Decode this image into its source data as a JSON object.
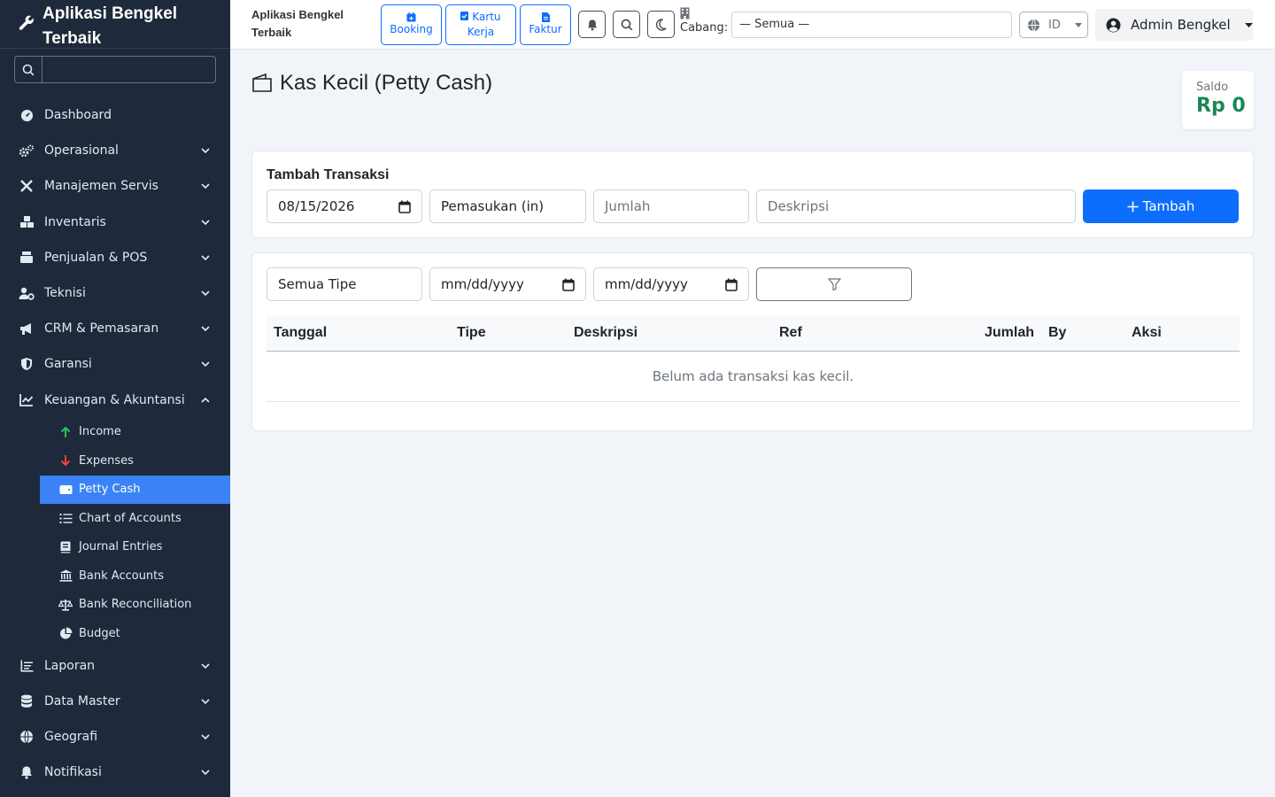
{
  "sidebar": {
    "brand": "Aplikasi Bengkel Terbaik",
    "search_placeholder": "",
    "items": [
      {
        "label": "Dashboard"
      },
      {
        "label": "Operasional"
      },
      {
        "label": "Manajemen Servis"
      },
      {
        "label": "Inventaris"
      },
      {
        "label": "Penjualan & POS"
      },
      {
        "label": "Teknisi"
      },
      {
        "label": "CRM & Pemasaran"
      },
      {
        "label": "Garansi"
      },
      {
        "label": "Keuangan & Akuntansi"
      }
    ],
    "sub_items": [
      {
        "label": "Income"
      },
      {
        "label": "Expenses"
      },
      {
        "label": "Petty Cash"
      },
      {
        "label": "Chart of Accounts"
      },
      {
        "label": "Journal Entries"
      },
      {
        "label": "Bank Accounts"
      },
      {
        "label": "Bank Reconciliation"
      },
      {
        "label": "Budget"
      }
    ],
    "items_after": [
      {
        "label": "Laporan"
      },
      {
        "label": "Data Master"
      },
      {
        "label": "Geografi"
      },
      {
        "label": "Notifikasi"
      }
    ]
  },
  "topbar": {
    "title": "Aplikasi Bengkel Terbaik",
    "booking": "Booking",
    "kartu_kerja": "Kartu Kerja",
    "faktur": "Faktur",
    "cabang_label": "Cabang:",
    "cabang_value": "— Semua —",
    "lang": "ID",
    "user": "Admin Bengkel"
  },
  "page": {
    "title": "Kas Kecil (Petty Cash)",
    "saldo_label": "Saldo",
    "saldo_value": "Rp 0"
  },
  "form": {
    "title": "Tambah Transaksi",
    "date": "08/15/2026",
    "type": "Pemasukan (in)",
    "amount_placeholder": "Jumlah",
    "desc_placeholder": "Deskripsi",
    "add_button": "Tambah"
  },
  "filter": {
    "type": "Semua Tipe",
    "date_from": "mm/dd/yyyy",
    "date_to": "mm/dd/yyyy"
  },
  "table": {
    "columns": [
      "Tanggal",
      "Tipe",
      "Deskripsi",
      "Ref",
      "Jumlah",
      "By",
      "Aksi"
    ],
    "empty_text": "Belum ada transaksi kas kecil."
  },
  "colors": {
    "sidebar_bg": "#1e293b",
    "active": "#3b82f6",
    "primary": "#0d6efd",
    "saldo": "#198754"
  }
}
